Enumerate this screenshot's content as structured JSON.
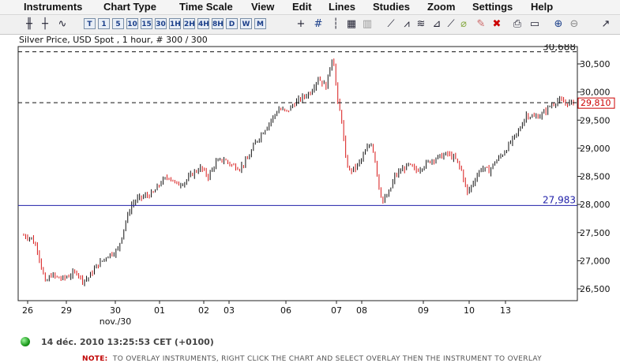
{
  "menu": [
    "Instruments",
    "Chart Type",
    "Time Scale",
    "View",
    "Edit",
    "Lines",
    "Studies",
    "Zoom",
    "Settings",
    "Help"
  ],
  "toolbar": {
    "timescale_buttons": [
      "T",
      "1",
      "5",
      "10",
      "15",
      "30",
      "1H",
      "2H",
      "4H",
      "8H",
      "D",
      "W",
      "M"
    ],
    "icons": [
      "candlestick-chart-icon",
      "bar-chart-icon",
      "line-chart-icon",
      "crosshair-icon",
      "grid-icon",
      "line-style-icon",
      "hatch-icon",
      "drawing-tools-icon",
      "eraser-icon",
      "delete-icon",
      "print-icon",
      "export-icon",
      "zoom-in-icon",
      "zoom-out-icon",
      "pin-icon"
    ]
  },
  "chart": {
    "title": "Silver Price, USD Spot , 1 hour, # 300 / 300",
    "high_label": "30,688",
    "low_label": "27,983",
    "last_label": "29,810",
    "colors": {
      "up": "#111111",
      "down": "#d81818",
      "support_line": "#1f1fa8",
      "last_box": "#cc0000"
    }
  },
  "chart_data": {
    "type": "candlestick",
    "title": "Silver Price, USD Spot , 1 hour, # 300 / 300",
    "y_ticks": [
      "30,500",
      "30,000",
      "29,500",
      "29,000",
      "28,500",
      "28,000",
      "27,500",
      "27,000",
      "26,500"
    ],
    "y_tick_values": [
      30500,
      30000,
      29500,
      29000,
      28500,
      28000,
      27500,
      27000,
      26500
    ],
    "x_ticks": [
      "26",
      "29",
      "30",
      "01",
      "02",
      "03",
      "06",
      "07",
      "08",
      "09",
      "10",
      "13"
    ],
    "x_sublabel": "nov./30",
    "ylim": [
      26300,
      30800
    ],
    "horizontal_lines": [
      {
        "value": 30688,
        "label": "30,688",
        "style": "dashed"
      },
      {
        "value": 29810,
        "label": "29,810",
        "style": "dashed"
      },
      {
        "value": 27983,
        "label": "27,983",
        "style": "solid"
      }
    ],
    "price_path": [
      [
        0,
        27450
      ],
      [
        4,
        27400
      ],
      [
        7,
        27200
      ],
      [
        9,
        26900
      ],
      [
        11,
        26600
      ],
      [
        14,
        26750
      ],
      [
        17,
        26700
      ],
      [
        20,
        26680
      ],
      [
        24,
        26750
      ],
      [
        27,
        26800
      ],
      [
        30,
        26650
      ],
      [
        33,
        26700
      ],
      [
        37,
        26900
      ],
      [
        40,
        27000
      ],
      [
        43,
        27100
      ],
      [
        46,
        27150
      ],
      [
        48,
        27200
      ],
      [
        50,
        27450
      ],
      [
        52,
        27700
      ],
      [
        55,
        28000
      ],
      [
        58,
        28100
      ],
      [
        62,
        28150
      ],
      [
        66,
        28200
      ],
      [
        70,
        28400
      ],
      [
        74,
        28500
      ],
      [
        78,
        28350
      ],
      [
        82,
        28400
      ],
      [
        86,
        28550
      ],
      [
        90,
        28650
      ],
      [
        94,
        28500
      ],
      [
        98,
        28750
      ],
      [
        102,
        28800
      ],
      [
        106,
        28700
      ],
      [
        110,
        28650
      ],
      [
        114,
        28800
      ],
      [
        118,
        29100
      ],
      [
        122,
        29300
      ],
      [
        126,
        29500
      ],
      [
        130,
        29700
      ],
      [
        134,
        29650
      ],
      [
        138,
        29800
      ],
      [
        142,
        29900
      ],
      [
        146,
        30000
      ],
      [
        150,
        30250
      ],
      [
        154,
        30100
      ],
      [
        157,
        30600
      ],
      [
        158,
        30500
      ],
      [
        160,
        29800
      ],
      [
        162,
        29500
      ],
      [
        164,
        28800
      ],
      [
        166,
        28600
      ],
      [
        169,
        28650
      ],
      [
        172,
        28800
      ],
      [
        175,
        29000
      ],
      [
        177,
        29100
      ],
      [
        179,
        28800
      ],
      [
        181,
        28300
      ],
      [
        183,
        28050
      ],
      [
        186,
        28200
      ],
      [
        189,
        28500
      ],
      [
        192,
        28600
      ],
      [
        196,
        28700
      ],
      [
        200,
        28600
      ],
      [
        204,
        28700
      ],
      [
        208,
        28800
      ],
      [
        212,
        28850
      ],
      [
        216,
        28900
      ],
      [
        220,
        28800
      ],
      [
        223,
        28600
      ],
      [
        226,
        28200
      ],
      [
        229,
        28400
      ],
      [
        233,
        28650
      ],
      [
        237,
        28600
      ],
      [
        240,
        28750
      ],
      [
        244,
        28900
      ],
      [
        248,
        29100
      ],
      [
        252,
        29300
      ],
      [
        256,
        29600
      ],
      [
        260,
        29550
      ],
      [
        264,
        29600
      ],
      [
        268,
        29750
      ],
      [
        272,
        29850
      ],
      [
        276,
        29800
      ],
      [
        280,
        29810
      ]
    ],
    "grid": true
  }
}
